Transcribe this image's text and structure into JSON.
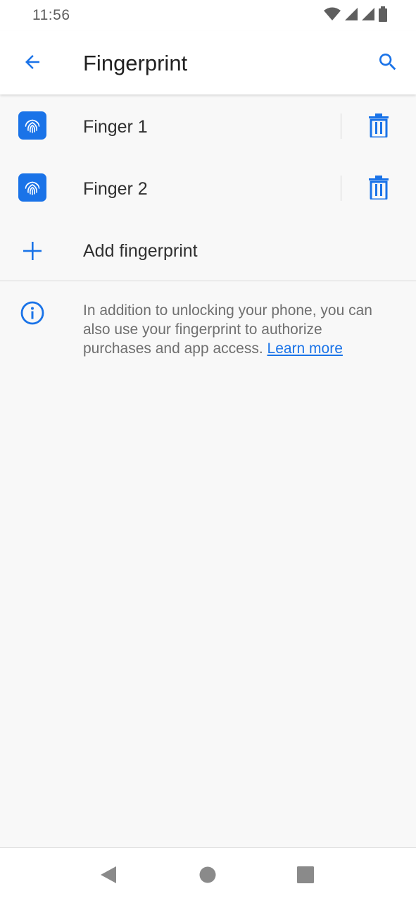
{
  "status_bar": {
    "time": "11:56",
    "icons": [
      "wifi-icon",
      "signal-icon",
      "signal-icon",
      "battery-icon"
    ]
  },
  "app_bar": {
    "title": "Fingerprint",
    "back_icon": "arrow-back-icon",
    "search_icon": "search-icon"
  },
  "fingerprints": [
    {
      "label": "Finger 1",
      "icon": "fingerprint-icon",
      "action_icon": "trash-icon"
    },
    {
      "label": "Finger 2",
      "icon": "fingerprint-icon",
      "action_icon": "trash-icon"
    }
  ],
  "add": {
    "label": "Add fingerprint",
    "icon": "plus-icon"
  },
  "info": {
    "icon": "info-icon",
    "text": "In addition to unlocking your phone, you can also use your fingerprint to authorize purchases and app access.",
    "link_label": "Learn more"
  },
  "nav_bar": {
    "icons": [
      "back-triangle-icon",
      "home-circle-icon",
      "recents-square-icon"
    ]
  },
  "colors": {
    "accent": "#1a73e8",
    "background": "#f8f8f8",
    "text_primary": "#212121",
    "text_secondary": "#6f6f6f"
  }
}
